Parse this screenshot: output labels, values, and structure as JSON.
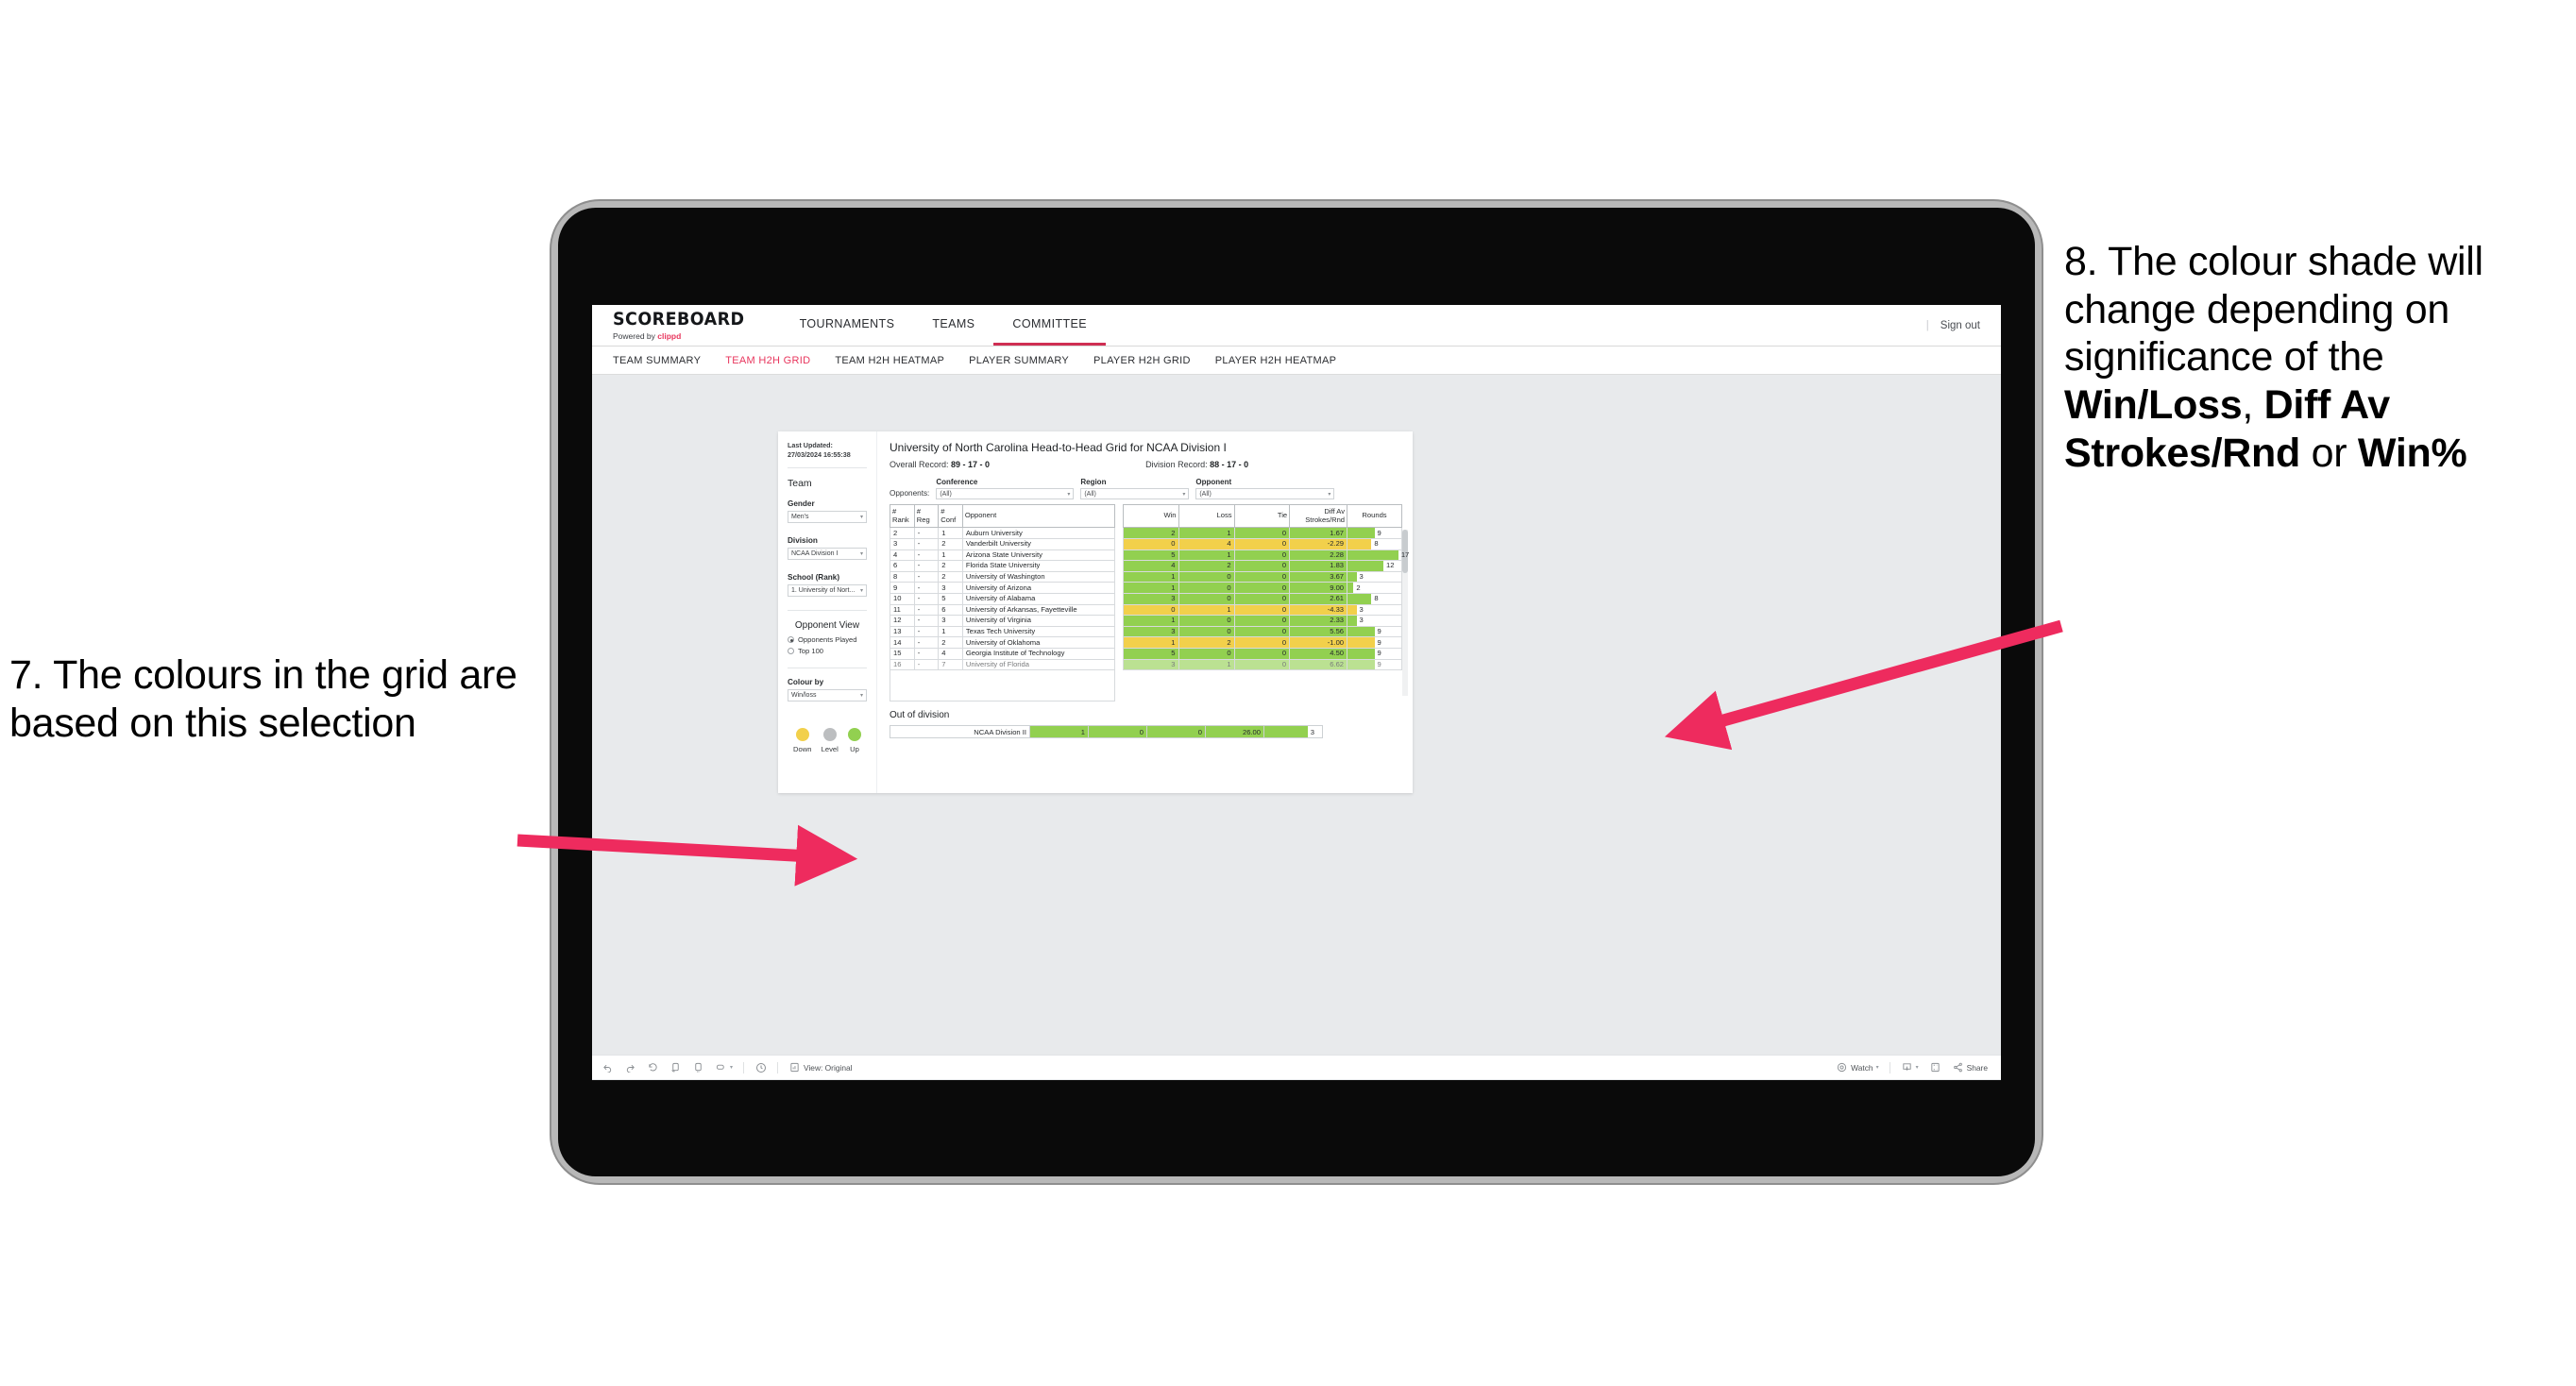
{
  "annotations": {
    "left": {
      "number": "7.",
      "text": "The colours in the grid are based on this selection"
    },
    "right": {
      "number": "8.",
      "lead": "The colour shade will change depending on significance of the ",
      "bold1": "Win/Loss",
      "mid1": ", ",
      "bold2": "Diff Av Strokes/Rnd",
      "mid2": " or ",
      "bold3": "Win%"
    },
    "arrow_color": "#ee2b5e"
  },
  "app": {
    "brand_title": "SCOREBOARD",
    "brand_sub_prefix": "Powered by ",
    "brand_sub_name": "clippd",
    "topnav": [
      {
        "label": "TOURNAMENTS",
        "active": false
      },
      {
        "label": "TEAMS",
        "active": false
      },
      {
        "label": "COMMITTEE",
        "active": true
      }
    ],
    "signout_divider": "|",
    "signout_label": "Sign out",
    "subnav": [
      {
        "label": "TEAM SUMMARY",
        "active": false
      },
      {
        "label": "TEAM H2H GRID",
        "active": true
      },
      {
        "label": "TEAM H2H HEATMAP",
        "active": false
      },
      {
        "label": "PLAYER SUMMARY",
        "active": false
      },
      {
        "label": "PLAYER H2H GRID",
        "active": false
      },
      {
        "label": "PLAYER H2H HEATMAP",
        "active": false
      }
    ],
    "accent_color": "#e8365d"
  },
  "filters": {
    "last_updated": "Last Updated: 27/03/2024 16:55:38",
    "team_heading": "Team",
    "gender_label": "Gender",
    "gender_value": "Men's",
    "division_label": "Division",
    "division_value": "NCAA Division I",
    "school_label": "School (Rank)",
    "school_value": "1. University of Nort...",
    "opponent_view_heading": "Opponent View",
    "radios": [
      {
        "label": "Opponents Played",
        "selected": true
      },
      {
        "label": "Top 100",
        "selected": false
      }
    ],
    "colour_by_label": "Colour by",
    "colour_by_value": "Win/loss",
    "legend": [
      {
        "caption": "Down",
        "color": "#f2d04b"
      },
      {
        "caption": "Level",
        "color": "#bcbec0"
      },
      {
        "caption": "Up",
        "color": "#92d050"
      }
    ]
  },
  "view": {
    "title": "University of North Carolina Head-to-Head Grid for NCAA Division I",
    "overall_record_label": "Overall Record: ",
    "overall_record_value": "89 - 17 - 0",
    "division_record_label": "Division Record: ",
    "division_record_value": "88 - 17 - 0",
    "opponents_label": "Opponents:",
    "opponent_filters": [
      {
        "caption": "Conference",
        "value": "(All)"
      },
      {
        "caption": "Region",
        "value": "(All)"
      },
      {
        "caption": "Opponent",
        "value": "(All)"
      }
    ]
  },
  "chart_data": {
    "type": "table",
    "title": "University of North Carolina Head-to-Head Grid for NCAA Division I",
    "columns": [
      "# Rank",
      "# Reg",
      "# Conf",
      "Opponent",
      "Win",
      "Loss",
      "Tie",
      "Diff Av Strokes/Rnd",
      "Rounds"
    ],
    "rows": [
      {
        "rank": "2",
        "reg": "-",
        "conf": "1",
        "opponent": "Auburn University",
        "win": "2",
        "loss": "1",
        "tie": "0",
        "diff": "1.67",
        "rounds": "9",
        "tone": "g"
      },
      {
        "rank": "3",
        "reg": "-",
        "conf": "2",
        "opponent": "Vanderbilt University",
        "win": "0",
        "loss": "4",
        "tie": "0",
        "diff": "-2.29",
        "rounds": "8",
        "tone": "y"
      },
      {
        "rank": "4",
        "reg": "-",
        "conf": "1",
        "opponent": "Arizona State University",
        "win": "5",
        "loss": "1",
        "tie": "0",
        "diff": "2.28",
        "rounds": "17",
        "tone": "g"
      },
      {
        "rank": "6",
        "reg": "-",
        "conf": "2",
        "opponent": "Florida State University",
        "win": "4",
        "loss": "2",
        "tie": "0",
        "diff": "1.83",
        "rounds": "12",
        "tone": "g"
      },
      {
        "rank": "8",
        "reg": "-",
        "conf": "2",
        "opponent": "University of Washington",
        "win": "1",
        "loss": "0",
        "tie": "0",
        "diff": "3.67",
        "rounds": "3",
        "tone": "g"
      },
      {
        "rank": "9",
        "reg": "-",
        "conf": "3",
        "opponent": "University of Arizona",
        "win": "1",
        "loss": "0",
        "tie": "0",
        "diff": "9.00",
        "rounds": "2",
        "tone": "g"
      },
      {
        "rank": "10",
        "reg": "-",
        "conf": "5",
        "opponent": "University of Alabama",
        "win": "3",
        "loss": "0",
        "tie": "0",
        "diff": "2.61",
        "rounds": "8",
        "tone": "g"
      },
      {
        "rank": "11",
        "reg": "-",
        "conf": "6",
        "opponent": "University of Arkansas, Fayetteville",
        "win": "0",
        "loss": "1",
        "tie": "0",
        "diff": "-4.33",
        "rounds": "3",
        "tone": "y"
      },
      {
        "rank": "12",
        "reg": "-",
        "conf": "3",
        "opponent": "University of Virginia",
        "win": "1",
        "loss": "0",
        "tie": "0",
        "diff": "2.33",
        "rounds": "3",
        "tone": "g"
      },
      {
        "rank": "13",
        "reg": "-",
        "conf": "1",
        "opponent": "Texas Tech University",
        "win": "3",
        "loss": "0",
        "tie": "0",
        "diff": "5.56",
        "rounds": "9",
        "tone": "g"
      },
      {
        "rank": "14",
        "reg": "-",
        "conf": "2",
        "opponent": "University of Oklahoma",
        "win": "1",
        "loss": "2",
        "tie": "0",
        "diff": "-1.00",
        "rounds": "9",
        "tone": "y"
      },
      {
        "rank": "15",
        "reg": "-",
        "conf": "4",
        "opponent": "Georgia Institute of Technology",
        "win": "5",
        "loss": "0",
        "tie": "0",
        "diff": "4.50",
        "rounds": "9",
        "tone": "g"
      },
      {
        "rank": "16",
        "reg": "-",
        "conf": "7",
        "opponent": "University of Florida",
        "win": "3",
        "loss": "1",
        "tie": "0",
        "diff": "6.62",
        "rounds": "9",
        "tone": "g"
      }
    ],
    "rounds_max": 18,
    "out_of_division": {
      "title": "Out of division",
      "row": {
        "opponent": "NCAA Division II",
        "win": "1",
        "loss": "0",
        "tie": "0",
        "diff": "26.00",
        "rounds": "3",
        "tone": "g"
      }
    },
    "colors": {
      "up": "#92d050",
      "down": "#f2d04b",
      "level": "#bcbec0"
    }
  },
  "toolbar": {
    "undo_icon": "undo-icon",
    "redo_icon": "redo-icon",
    "revert_icon": "revert-icon",
    "refresh_icon": "refresh-icon",
    "pause_icon": "pause-icon",
    "alerts_icon": "alerts-icon",
    "clock_icon": "clock-icon",
    "view_icon": "view-icon",
    "view_label": "View: Original",
    "watch_label": "Watch",
    "download_icon": "download-icon",
    "fullscreen_icon": "fullscreen-icon",
    "share_label": "Share"
  }
}
